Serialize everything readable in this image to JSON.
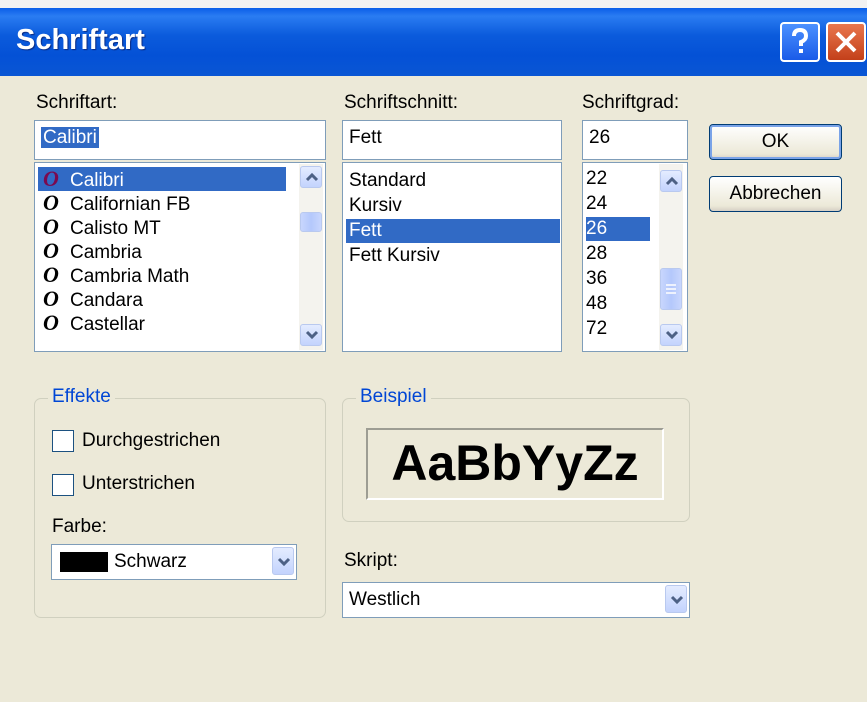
{
  "window": {
    "title": "Schriftart"
  },
  "title_buttons": {
    "help_icon": "help-icon",
    "close_icon": "close-icon"
  },
  "font": {
    "label": "Schriftart:",
    "value": "Calibri",
    "items": [
      "Calibri",
      "Californian FB",
      "Calisto MT",
      "Cambria",
      "Cambria Math",
      "Candara",
      "Castellar"
    ],
    "selected": "Calibri"
  },
  "style": {
    "label": "Schriftschnitt:",
    "value": "Fett",
    "items": [
      "Standard",
      "Kursiv",
      "Fett",
      "Fett Kursiv"
    ],
    "selected": "Fett"
  },
  "size": {
    "label": "Schriftgrad:",
    "value": "26",
    "items": [
      "22",
      "24",
      "26",
      "28",
      "36",
      "48",
      "72"
    ],
    "selected": "26"
  },
  "buttons": {
    "ok": "OK",
    "cancel": "Abbrechen"
  },
  "effects": {
    "legend": "Effekte",
    "strikeout": {
      "label": "Durchgestrichen",
      "checked": false
    },
    "underline": {
      "label": "Unterstrichen",
      "checked": false
    },
    "color_label": "Farbe:",
    "color_value": "Schwarz",
    "color_hex": "#000000"
  },
  "sample": {
    "legend": "Beispiel",
    "text": "AaBbYyZz"
  },
  "script": {
    "label": "Skript:",
    "value": "Westlich"
  },
  "colors": {
    "titlebar": "#0451d6",
    "selection": "#316ac5",
    "legend_text": "#0046d5",
    "face": "#ece9d8"
  }
}
